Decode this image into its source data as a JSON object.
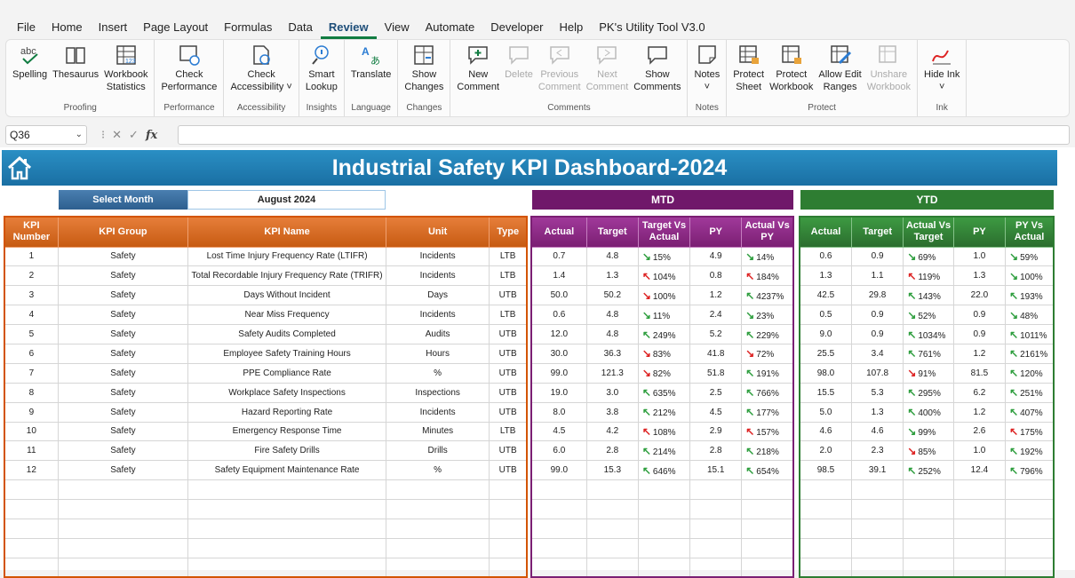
{
  "menu": {
    "tabs": [
      "File",
      "Home",
      "Insert",
      "Page Layout",
      "Formulas",
      "Data",
      "Review",
      "View",
      "Automate",
      "Developer",
      "Help",
      "PK's Utility Tool V3.0"
    ],
    "active": "Review"
  },
  "ribbon": {
    "groups": [
      {
        "label": "Proofing",
        "buttons": [
          {
            "label": "Spelling",
            "icon": "spelling-icon"
          },
          {
            "label": "Thesaurus",
            "icon": "book-icon"
          },
          {
            "label": "Workbook Statistics",
            "icon": "statistics-icon"
          }
        ]
      },
      {
        "label": "Performance",
        "buttons": [
          {
            "label": "Check Performance",
            "icon": "performance-icon"
          }
        ]
      },
      {
        "label": "Accessibility",
        "buttons": [
          {
            "label": "Check Accessibility ˅",
            "icon": "accessibility-icon"
          }
        ]
      },
      {
        "label": "Insights",
        "buttons": [
          {
            "label": "Smart Lookup",
            "icon": "lookup-icon"
          }
        ]
      },
      {
        "label": "Language",
        "buttons": [
          {
            "label": "Translate",
            "icon": "translate-icon"
          }
        ]
      },
      {
        "label": "Changes",
        "buttons": [
          {
            "label": "Show Changes",
            "icon": "changes-icon"
          }
        ]
      },
      {
        "label": "Comments",
        "buttons": [
          {
            "label": "New Comment",
            "icon": "new-comment-icon"
          },
          {
            "label": "Delete",
            "icon": "delete-comment-icon",
            "disabled": true
          },
          {
            "label": "Previous Comment",
            "icon": "previous-comment-icon",
            "disabled": true
          },
          {
            "label": "Next Comment",
            "icon": "next-comment-icon",
            "disabled": true
          },
          {
            "label": "Show Comments",
            "icon": "show-comments-icon"
          }
        ]
      },
      {
        "label": "Notes",
        "buttons": [
          {
            "label": "Notes ˅",
            "icon": "notes-icon"
          }
        ]
      },
      {
        "label": "Protect",
        "buttons": [
          {
            "label": "Protect Sheet",
            "icon": "protect-sheet-icon"
          },
          {
            "label": "Protect Workbook",
            "icon": "protect-workbook-icon"
          },
          {
            "label": "Allow Edit Ranges",
            "icon": "edit-ranges-icon"
          },
          {
            "label": "Unshare Workbook",
            "icon": "unshare-icon",
            "disabled": true
          }
        ]
      },
      {
        "label": "Ink",
        "buttons": [
          {
            "label": "Hide Ink ˅",
            "icon": "ink-icon"
          }
        ]
      }
    ]
  },
  "formula_bar": {
    "name_box": "Q36",
    "fx": "fx"
  },
  "dashboard": {
    "title": "Industrial Safety KPI Dashboard-2024",
    "select_month_label": "Select Month",
    "month_value": "August 2024",
    "mtd_label": "MTD",
    "ytd_label": "YTD",
    "main_headers": [
      "KPI Number",
      "KPI Group",
      "KPI Name",
      "Unit",
      "Type"
    ],
    "mtd_headers": [
      "Actual",
      "Target",
      "Target Vs Actual",
      "PY",
      "Actual Vs PY"
    ],
    "ytd_headers": [
      "Actual",
      "Target",
      "Actual Vs Target",
      "PY",
      "PY Vs Actual"
    ],
    "rows": [
      {
        "num": "1",
        "group": "Safety",
        "name": "Lost Time Injury Frequency Rate (LTIFR)",
        "unit": "Incidents",
        "type": "LTB",
        "m_act": "0.7",
        "m_tgt": "4.8",
        "m_tva": "15%",
        "m_tva_dir": "down-green",
        "m_py": "4.9",
        "m_avp": "14%",
        "m_avp_dir": "down-green",
        "y_act": "0.6",
        "y_tgt": "0.9",
        "y_avt": "69%",
        "y_avt_dir": "down-green",
        "y_py": "1.0",
        "y_pva": "59%",
        "y_pva_dir": "down-green"
      },
      {
        "num": "2",
        "group": "Safety",
        "name": "Total Recordable Injury Frequency Rate (TRIFR)",
        "unit": "Incidents",
        "type": "LTB",
        "m_act": "1.4",
        "m_tgt": "1.3",
        "m_tva": "104%",
        "m_tva_dir": "up-red",
        "m_py": "0.8",
        "m_avp": "184%",
        "m_avp_dir": "up-red",
        "y_act": "1.3",
        "y_tgt": "1.1",
        "y_avt": "119%",
        "y_avt_dir": "up-red",
        "y_py": "1.3",
        "y_pva": "100%",
        "y_pva_dir": "down-green"
      },
      {
        "num": "3",
        "group": "Safety",
        "name": "Days Without Incident",
        "unit": "Days",
        "type": "UTB",
        "m_act": "50.0",
        "m_tgt": "50.2",
        "m_tva": "100%",
        "m_tva_dir": "down-red",
        "m_py": "1.2",
        "m_avp": "4237%",
        "m_avp_dir": "up-green",
        "y_act": "42.5",
        "y_tgt": "29.8",
        "y_avt": "143%",
        "y_avt_dir": "up-green",
        "y_py": "22.0",
        "y_pva": "193%",
        "y_pva_dir": "up-green"
      },
      {
        "num": "4",
        "group": "Safety",
        "name": "Near Miss Frequency",
        "unit": "Incidents",
        "type": "LTB",
        "m_act": "0.6",
        "m_tgt": "4.8",
        "m_tva": "11%",
        "m_tva_dir": "down-green",
        "m_py": "2.4",
        "m_avp": "23%",
        "m_avp_dir": "down-green",
        "y_act": "0.5",
        "y_tgt": "0.9",
        "y_avt": "52%",
        "y_avt_dir": "down-green",
        "y_py": "0.9",
        "y_pva": "48%",
        "y_pva_dir": "down-green"
      },
      {
        "num": "5",
        "group": "Safety",
        "name": "Safety Audits Completed",
        "unit": "Audits",
        "type": "UTB",
        "m_act": "12.0",
        "m_tgt": "4.8",
        "m_tva": "249%",
        "m_tva_dir": "up-green",
        "m_py": "5.2",
        "m_avp": "229%",
        "m_avp_dir": "up-green",
        "y_act": "9.0",
        "y_tgt": "0.9",
        "y_avt": "1034%",
        "y_avt_dir": "up-green",
        "y_py": "0.9",
        "y_pva": "1011%",
        "y_pva_dir": "up-green"
      },
      {
        "num": "6",
        "group": "Safety",
        "name": "Employee Safety Training Hours",
        "unit": "Hours",
        "type": "UTB",
        "m_act": "30.0",
        "m_tgt": "36.3",
        "m_tva": "83%",
        "m_tva_dir": "down-red",
        "m_py": "41.8",
        "m_avp": "72%",
        "m_avp_dir": "down-red",
        "y_act": "25.5",
        "y_tgt": "3.4",
        "y_avt": "761%",
        "y_avt_dir": "up-green",
        "y_py": "1.2",
        "y_pva": "2161%",
        "y_pva_dir": "up-green"
      },
      {
        "num": "7",
        "group": "Safety",
        "name": "PPE Compliance Rate",
        "unit": "%",
        "type": "UTB",
        "m_act": "99.0",
        "m_tgt": "121.3",
        "m_tva": "82%",
        "m_tva_dir": "down-red",
        "m_py": "51.8",
        "m_avp": "191%",
        "m_avp_dir": "up-green",
        "y_act": "98.0",
        "y_tgt": "107.8",
        "y_avt": "91%",
        "y_avt_dir": "down-red",
        "y_py": "81.5",
        "y_pva": "120%",
        "y_pva_dir": "up-green"
      },
      {
        "num": "8",
        "group": "Safety",
        "name": "Workplace Safety Inspections",
        "unit": "Inspections",
        "type": "UTB",
        "m_act": "19.0",
        "m_tgt": "3.0",
        "m_tva": "635%",
        "m_tva_dir": "up-green",
        "m_py": "2.5",
        "m_avp": "766%",
        "m_avp_dir": "up-green",
        "y_act": "15.5",
        "y_tgt": "5.3",
        "y_avt": "295%",
        "y_avt_dir": "up-green",
        "y_py": "6.2",
        "y_pva": "251%",
        "y_pva_dir": "up-green"
      },
      {
        "num": "9",
        "group": "Safety",
        "name": "Hazard Reporting Rate",
        "unit": "Incidents",
        "type": "UTB",
        "m_act": "8.0",
        "m_tgt": "3.8",
        "m_tva": "212%",
        "m_tva_dir": "up-green",
        "m_py": "4.5",
        "m_avp": "177%",
        "m_avp_dir": "up-green",
        "y_act": "5.0",
        "y_tgt": "1.3",
        "y_avt": "400%",
        "y_avt_dir": "up-green",
        "y_py": "1.2",
        "y_pva": "407%",
        "y_pva_dir": "up-green"
      },
      {
        "num": "10",
        "group": "Safety",
        "name": "Emergency Response Time",
        "unit": "Minutes",
        "type": "LTB",
        "m_act": "4.5",
        "m_tgt": "4.2",
        "m_tva": "108%",
        "m_tva_dir": "up-red",
        "m_py": "2.9",
        "m_avp": "157%",
        "m_avp_dir": "up-red",
        "y_act": "4.6",
        "y_tgt": "4.6",
        "y_avt": "99%",
        "y_avt_dir": "down-green",
        "y_py": "2.6",
        "y_pva": "175%",
        "y_pva_dir": "up-red"
      },
      {
        "num": "11",
        "group": "Safety",
        "name": "Fire Safety Drills",
        "unit": "Drills",
        "type": "UTB",
        "m_act": "6.0",
        "m_tgt": "2.8",
        "m_tva": "214%",
        "m_tva_dir": "up-green",
        "m_py": "2.8",
        "m_avp": "218%",
        "m_avp_dir": "up-green",
        "y_act": "2.0",
        "y_tgt": "2.3",
        "y_avt": "85%",
        "y_avt_dir": "down-red",
        "y_py": "1.0",
        "y_pva": "192%",
        "y_pva_dir": "up-green"
      },
      {
        "num": "12",
        "group": "Safety",
        "name": "Safety Equipment Maintenance Rate",
        "unit": "%",
        "type": "UTB",
        "m_act": "99.0",
        "m_tgt": "15.3",
        "m_tva": "646%",
        "m_tva_dir": "up-green",
        "m_py": "15.1",
        "m_avp": "654%",
        "m_avp_dir": "up-green",
        "y_act": "98.5",
        "y_tgt": "39.1",
        "y_avt": "252%",
        "y_avt_dir": "up-green",
        "y_py": "12.4",
        "y_pva": "796%",
        "y_pva_dir": "up-green"
      }
    ],
    "empty_rows": 5
  }
}
